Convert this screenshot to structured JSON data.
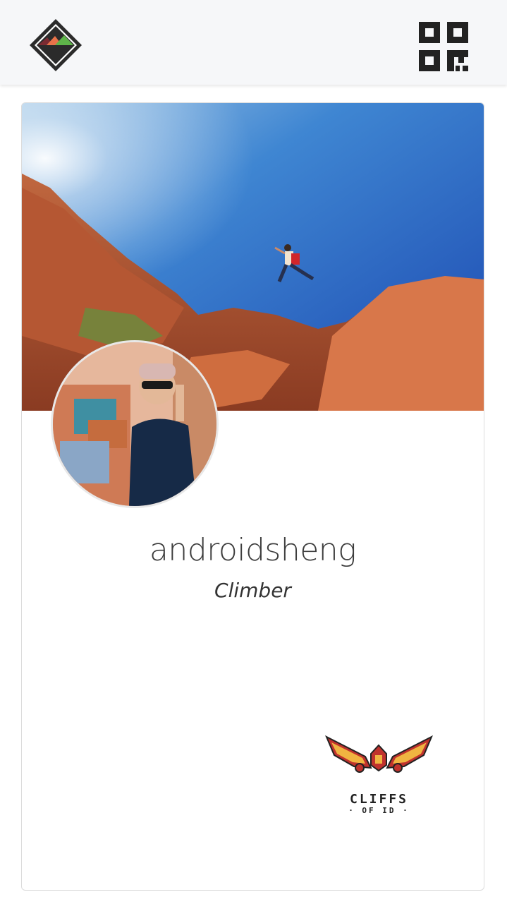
{
  "header": {
    "logo_icon": "mountain-diamond-logo-icon",
    "qr_icon": "qr-code-icon"
  },
  "profile": {
    "cover_image": "cover-photo-climber-jumping-red-rocks",
    "avatar_image": "avatar-photo-person-peace-sign",
    "username": "androidsheng",
    "role": "Climber"
  },
  "sponsor": {
    "logo_icon": "cliffs-of-id-winged-logo-icon",
    "name": "CLIFFS",
    "sub": "· OF ID ·"
  },
  "colors": {
    "topbar_bg": "#f6f7f9",
    "card_border": "#dcdcdc",
    "sky": "#1f5ec4",
    "rock": "#c8613c",
    "brand_red": "#c0322d",
    "brand_yellow": "#f0b441"
  }
}
